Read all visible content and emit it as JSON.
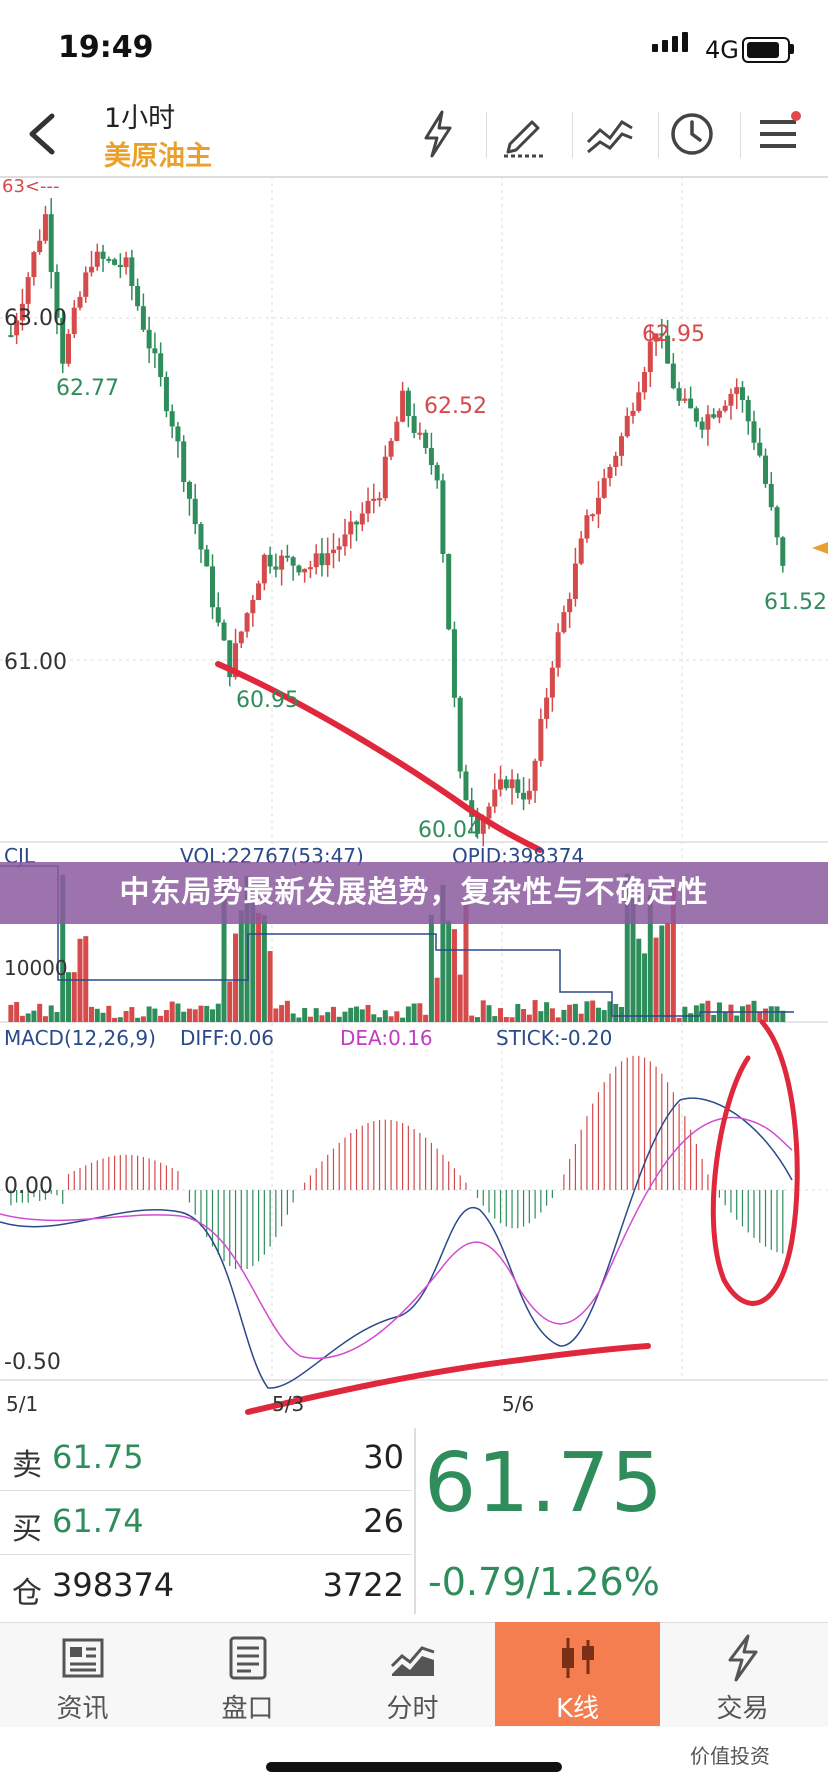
{
  "status": {
    "time": "19:49",
    "network": "4G"
  },
  "nav": {
    "title": "1小时",
    "subtitle": "美原油主"
  },
  "chart": {
    "price_labels": {
      "axis_top": "63.00",
      "axis_bottom": "61.00",
      "top_left_marker": "63<---",
      "hi_1": "62.77",
      "low_1": "60.95",
      "hi_2": "62.52",
      "low_2": "60.04",
      "hi_3": "62.95",
      "last": "61.52"
    },
    "volume": {
      "label_cjl": "CJL",
      "vol_label": "VOL:22767(53:47)",
      "opid_label": "OPID:398374",
      "axis_label": "10000"
    },
    "macd": {
      "label": "MACD(12,26,9)",
      "diff": "DIFF:0.06",
      "dea": "DEA:0.16",
      "stick": "STICK:-0.20",
      "axis_zero": "0.00",
      "axis_low": "-0.50"
    },
    "x_axis": [
      "5/1",
      "5/3",
      "5/6"
    ]
  },
  "quote": {
    "sell_label": "卖",
    "sell_price": "61.75",
    "sell_vol": "30",
    "buy_label": "买",
    "buy_price": "61.74",
    "buy_vol": "26",
    "pos_label": "仓",
    "pos_value": "398374",
    "pos_change": "3722",
    "last_price": "61.75",
    "change": "-0.79/1.26%"
  },
  "tabs": [
    {
      "label": "资讯",
      "icon": "news-icon"
    },
    {
      "label": "盘口",
      "icon": "orderbook-icon"
    },
    {
      "label": "分时",
      "icon": "timeshare-icon"
    },
    {
      "label": "K线",
      "icon": "candlestick-icon",
      "active": true
    },
    {
      "label": "交易",
      "icon": "trade-icon"
    }
  ],
  "overlay": {
    "headline": "中东局势最新发展趋势，复杂性与不确定性"
  },
  "watermark": "价值投资",
  "colors": {
    "up": "#d54a4a",
    "down": "#2e8d5a",
    "accent": "#f47e4f",
    "subtitle": "#e9a12b"
  },
  "chart_data": {
    "type": "candlestick",
    "title": "1小时 美原油主",
    "price_range": [
      59.9,
      63.2
    ],
    "price_ticks": [
      63.0,
      61.0
    ],
    "annotated_points": [
      {
        "label": "62.77",
        "value": 62.77
      },
      {
        "label": "60.95",
        "value": 60.95
      },
      {
        "label": "62.52",
        "value": 62.52
      },
      {
        "label": "60.04",
        "value": 60.04
      },
      {
        "label": "62.95",
        "value": 62.95
      },
      {
        "label": "61.52",
        "value": 61.52
      }
    ],
    "x_ticks": [
      "5/1",
      "5/3",
      "5/6"
    ],
    "macd": {
      "diff": 0.06,
      "dea": 0.16,
      "stick": -0.2,
      "range": [
        -0.6,
        0.55
      ]
    },
    "volume": {
      "vol": 22767,
      "opid": 398374
    }
  }
}
